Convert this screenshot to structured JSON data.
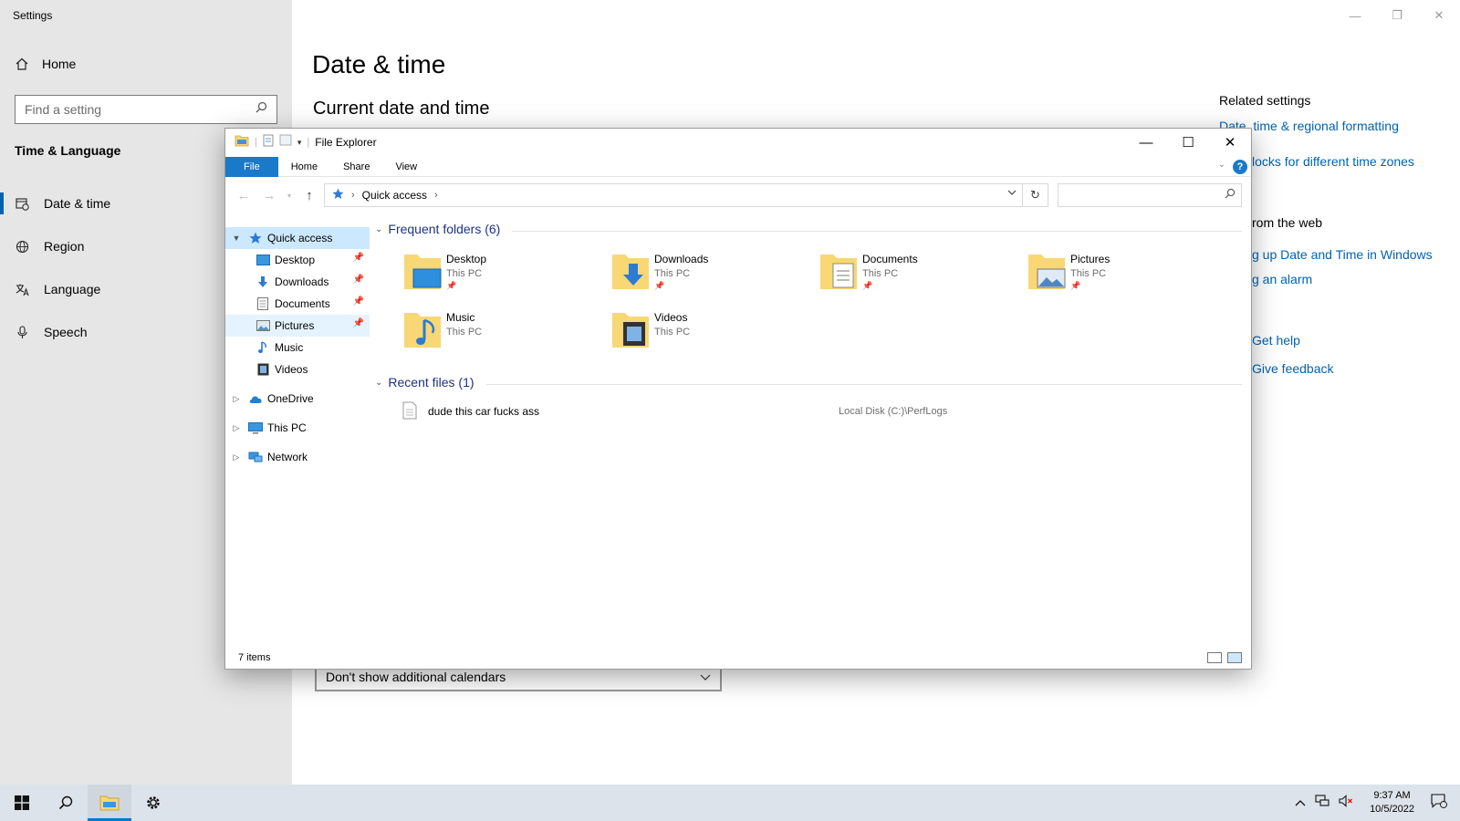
{
  "settings": {
    "window_title": "Settings",
    "home": "Home",
    "search_placeholder": "Find a setting",
    "section": "Time & Language",
    "nav": [
      {
        "label": "Date & time",
        "icon": "calendar-clock-icon",
        "active": true
      },
      {
        "label": "Region",
        "icon": "globe-icon",
        "active": false
      },
      {
        "label": "Language",
        "icon": "language-icon",
        "active": false
      },
      {
        "label": "Speech",
        "icon": "microphone-icon",
        "active": false
      }
    ],
    "page_title": "Date & time",
    "subheading": "Current date and time",
    "related_heading": "Related settings",
    "related_links": [
      "Date, time & regional formatting",
      "locks for different time zones"
    ],
    "web_heading": "rom the web",
    "web_links": [
      "g up Date and Time in Windows",
      "g an alarm"
    ],
    "help_links": [
      "Get help",
      "Give feedback"
    ],
    "calendar_select": "Don't show additional calendars"
  },
  "explorer": {
    "title": "File Explorer",
    "ribbon_tabs": [
      "File",
      "Home",
      "Share",
      "View"
    ],
    "help": "?",
    "address": "Quick access",
    "search_placeholder": "",
    "tree": [
      {
        "label": "Quick access",
        "icon": "star-icon",
        "level": 0,
        "expanded": true,
        "selected": true
      },
      {
        "label": "Desktop",
        "icon": "desktop-icon",
        "level": 1,
        "pinned": true
      },
      {
        "label": "Downloads",
        "icon": "download-icon",
        "level": 1,
        "pinned": true
      },
      {
        "label": "Documents",
        "icon": "document-icon",
        "level": 1,
        "pinned": true
      },
      {
        "label": "Pictures",
        "icon": "picture-icon",
        "level": 1,
        "pinned": true,
        "hover": true
      },
      {
        "label": "Music",
        "icon": "music-icon",
        "level": 1,
        "pinned": false
      },
      {
        "label": "Videos",
        "icon": "video-icon",
        "level": 1,
        "pinned": false
      },
      {
        "label": "OneDrive",
        "icon": "cloud-icon",
        "level": 0,
        "expanded": false
      },
      {
        "label": "This PC",
        "icon": "computer-icon",
        "level": 0,
        "expanded": false
      },
      {
        "label": "Network",
        "icon": "network-icon",
        "level": 0,
        "expanded": false
      }
    ],
    "frequent_heading": "Frequent folders (6)",
    "folders": [
      {
        "name": "Desktop",
        "location": "This PC",
        "pinned": true,
        "icon": "desktop-folder-icon"
      },
      {
        "name": "Downloads",
        "location": "This PC",
        "pinned": true,
        "icon": "downloads-folder-icon"
      },
      {
        "name": "Documents",
        "location": "This PC",
        "pinned": true,
        "icon": "documents-folder-icon"
      },
      {
        "name": "Pictures",
        "location": "This PC",
        "pinned": true,
        "icon": "pictures-folder-icon"
      },
      {
        "name": "Music",
        "location": "This PC",
        "pinned": false,
        "icon": "music-folder-icon"
      },
      {
        "name": "Videos",
        "location": "This PC",
        "pinned": false,
        "icon": "videos-folder-icon"
      }
    ],
    "recent_heading": "Recent files (1)",
    "recent_files": [
      {
        "name": "dude this car fucks ass",
        "path": "Local Disk (C:)\\PerfLogs"
      }
    ],
    "status": "7 items"
  },
  "taskbar": {
    "time": "9:37 AM",
    "date": "10/5/2022"
  },
  "colors": {
    "accent": "#0063b1",
    "ribbon_file": "#1979ca",
    "tree_selected": "#cce8ff",
    "group_heading": "#1e3287",
    "folder": "#f8d775"
  }
}
